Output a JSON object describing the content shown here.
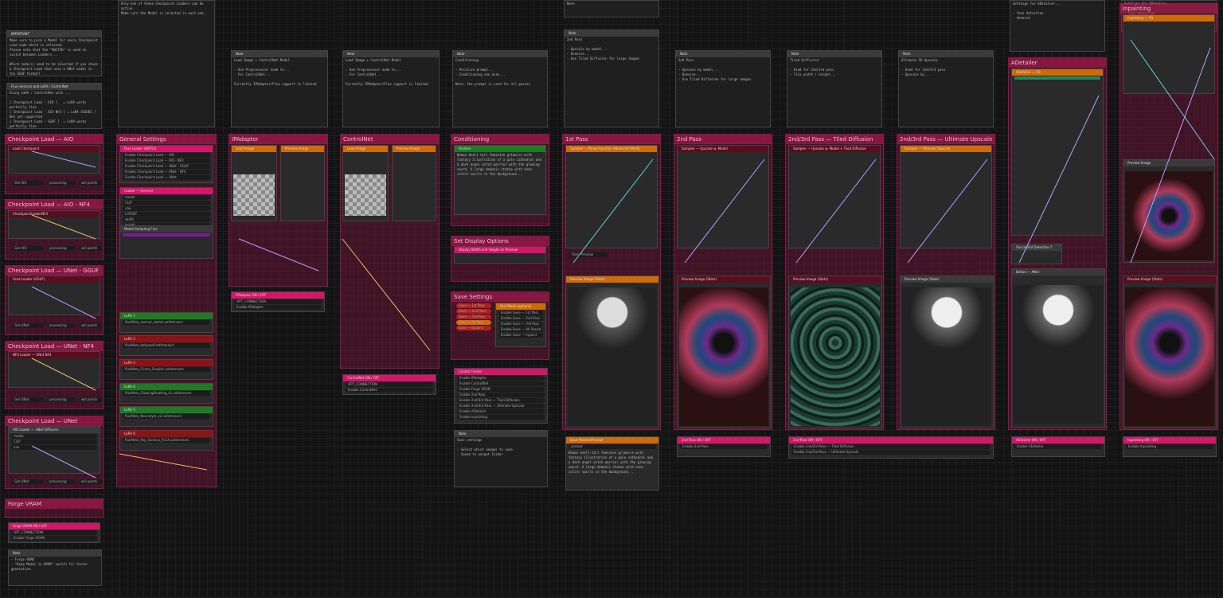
{
  "groups": [
    {
      "id": "g1",
      "title": "Checkpoint Load — AIO"
    },
    {
      "id": "g2",
      "title": "Checkpoint Load — AIO - NF4"
    },
    {
      "id": "g3",
      "title": "Checkpoint Load — UNet - GGUF"
    },
    {
      "id": "g4",
      "title": "Checkpoint Load — UNet - NF4"
    },
    {
      "id": "g5",
      "title": "Checkpoint Load — UNet"
    },
    {
      "id": "g6",
      "title": "Forge VRAM"
    },
    {
      "id": "g7",
      "title": "General Settings"
    },
    {
      "id": "g8",
      "title": "IPAdapter"
    },
    {
      "id": "g9",
      "title": "ControlNet"
    },
    {
      "id": "g10",
      "title": "Conditioning"
    },
    {
      "id": "g11",
      "title": "Set Display Options"
    },
    {
      "id": "g12",
      "title": "Save Settings"
    },
    {
      "id": "g13",
      "title": "1st Pass"
    },
    {
      "id": "g14",
      "title": "2nd Pass"
    },
    {
      "id": "g15",
      "title": "2nd/3rd Pass — Tiled Diffusion"
    },
    {
      "id": "g16",
      "title": "2nd/3rd Pass — Ultimate Upscale"
    },
    {
      "id": "g17",
      "title": "ADetailer"
    },
    {
      "id": "g18",
      "title": "Inpainting"
    }
  ],
  "notes": {
    "important": "IMPORTANT",
    "important_text": "Make sure to pick a Model for every Checkpoint Load node which is selected.\nPlease note that the \"SWITCH\" is used to switch between Loaders...\n\nWhich node(s) need to be selected if you chose a Checkpoint Load that uses a UNet model in the GGUF format?",
    "flux_versions": "Flux versions and LoRA / ControlNet",
    "flux_text": "Using LoRA / ControlNet with ...\n\n[ Checkpoint Load - AIO ]   = LoRA works perfectly fine\n[ Checkpoint Load - AIO NF4 ] = LoRA ISSUES / Not yet supported\n[ Checkpoint Load - GGUF ]  = LoRA works perfectly fine\n[ Checkpoint Load - UNet NF4 ] = LoRA ISSUES / Not yet supported\n[ Checkpoint Load - Diffusers ] = Both work perfectly fine",
    "note_label": "Note",
    "note_text_a": "Load Image + ControlNet Model\n\n- Use Preprocessor node to...\n- For ControlNet...\n\nCurrently IPAdapter/Flux support is limited",
    "note_text_b": "Conditioning\n\n- Positive prompt...\n- Conditioning one uses...\n\nNote: the prompt is used for all passes",
    "note_text_c": "Only one of these Checkpoint Loaders can be active.\nMake sure the Model is selected in each one.",
    "note_text_d": "2nd Pass\n\n- Upscale by model...\n- Denoise...\n- Use Tiled Diffusion for large images",
    "note_text_e": "Tiled Diffusion\n\n- Used for 2nd/3rd pass\n- Tile width / height...",
    "note_text_f": "Ultimate SD Upscale\n\n- Used for 2nd/3rd pass\n- Upscale by...",
    "note_text_g": "Settings for ADetailer...\n\n- face detection\n- denoise",
    "note_text_h": "Save settings\n\n- Select which images to save\n- Saved to output folder",
    "note_text_i": "- Forge VRAM\n- \"Keep Model in VRAM\" switch for faster generation."
  },
  "nodes": {
    "load_checkpoint": "Load Checkpoint",
    "checkpoint_loader_nf4": "CheckpointLoaderNF4",
    "unet_gguf": "Unet Loader (GGUF)",
    "unet_nf4": "NF4 Loader — UNet NF4",
    "aio_unet": "AIO Loader — UNet Diffusers",
    "get_aio": "Get AIO",
    "get_unet": "Get UNet",
    "processing": "processing",
    "will_points": "will points",
    "forge_vram": "Forge VRAM",
    "forge_vram_toggle": "Forge VRAM ON / OFF",
    "enable_forge_vram": "Enable Forge VRAM",
    "opt_connection": "OPT_CONNECTION",
    "flux_loader_switch": "Flux Loader SWITCH",
    "switch_items": [
      "Enable Checkpoint Load — AIO",
      "Enable Checkpoint Load — AIO - NF4",
      "Enable Checkpoint Load — UNet - GGUF",
      "Enable Checkpoint Load — UNet - NF4",
      "Enable Checkpoint Load — UNet"
    ],
    "loader_general": "Loader — General",
    "loader_outputs": [
      "model",
      "CLIP",
      "vae",
      "LATENT",
      "width",
      "height",
      "batchframes"
    ],
    "model_sampling": "Model Sampling Flux",
    "lora_rows": [
      "LoRA 1",
      "LoRA 2",
      "LoRA 3",
      "LoRA 4",
      "LoRA 5",
      "LoRA 6"
    ],
    "lora_names": [
      "fluxMeta_eternal_sketch.safetensors",
      "fluxMeta_babywolf.safetensors",
      "fluxMeta_Cones_Graphic.safetensors",
      "fluxMeta_GlowingDrawing_v1.safetensors",
      "fluxMeta_Neonstyle_v2.safetensors",
      "fluxMeta_Pop_Fantasy_FLUX.safetensors"
    ],
    "ipadapter_toggle": "IPAdapter ON / OFF",
    "enable_ipadapter": "Enable IPAdapter",
    "controlnet_toggle": "ControlNet ON / OFF",
    "enable_controlnet": "Enable ControlNet",
    "load_image": "Load Image",
    "preview_image": "Preview Image",
    "positive": "Positive",
    "prompt_text": "Woman knelt tall feminine grimoire with fantasy illustration of a pale cathedral and a dark angel witch warrior with the glowing sword. A large demonic statue with neon colors swirls in the background...",
    "display_wh": "Display Width and Height on Preview",
    "control_center": "Control Center",
    "control_items": [
      "Enable IPAdapter",
      "Enable ControlNet",
      "Enable Forge VRAM",
      "Enable 2nd Pass",
      "Enable 2nd/3rd Pass — Tiled Diffusion",
      "Enable 2nd/3rd Pass — Ultimate Upscale",
      "Enable ADetailer",
      "Enable Inpainting"
    ],
    "save_items": [
      "Save — 1st Pass",
      "Save — 2nd Pass",
      "Save — 3rd Pass",
      "Save — All Pass",
      "Save — Inpaint"
    ],
    "save_flags": [
      "Enable Save — 1st Pass",
      "Enable Save — 2nd Pass",
      "Enable Save — 3rd Pass",
      "Enable Save — All Passes",
      "Enable Save — Inpaint"
    ],
    "fast_mode": "Fast Mode (options)",
    "sampler_1st": "Sampler — Noise Injection Advanced (Multi)",
    "sampler_2nd": "Sampler — Upscale w. Model",
    "sampler_tiled": "Sampler — Upscale w. Model + Tiled Diffusion",
    "sampler_ultimate": "Sampler — Ultimate Upscale",
    "preview_image_stats": "Preview Image (Stats)",
    "stats_preview": "Stats Preview",
    "pass_toggle_2nd": "2nd Pass ON / OFF",
    "pass_toggle_tiled": "2nd Pass ON / OFF",
    "enable_2nd": "Enable 2nd Pass",
    "enable_tiled": "Enable 2nd/3rd Pass — Tiled Diffusion",
    "enable_ultimate": "Enable 2nd/3rd Pass — Ultimate Upscale",
    "adetailer_node": "ADetailer — FD",
    "adetailer_toggle": "ADetailer ON / OFF",
    "enable_adetailer": "Enable ADetailer",
    "inpainting_node": "Inpainting — FD",
    "inpainting_toggle": "Inpainting ON / OFF",
    "enable_inpainting": "Enable Inpainting",
    "successful_detection": "Successful Detection ?",
    "before_after": "Before — After",
    "save_params": "Save Params/Prompt",
    "prompt_label": "prompt"
  },
  "colors": {
    "group": "#961446",
    "header_pink": "#d6156a",
    "header_green": "#1f7a24",
    "header_orange": "#cf6a08",
    "header_red": "#8c1216",
    "wire_cyan": "#5fd0e0",
    "wire_lavender": "#b0a0ff",
    "wire_yellow": "#e8c060"
  }
}
